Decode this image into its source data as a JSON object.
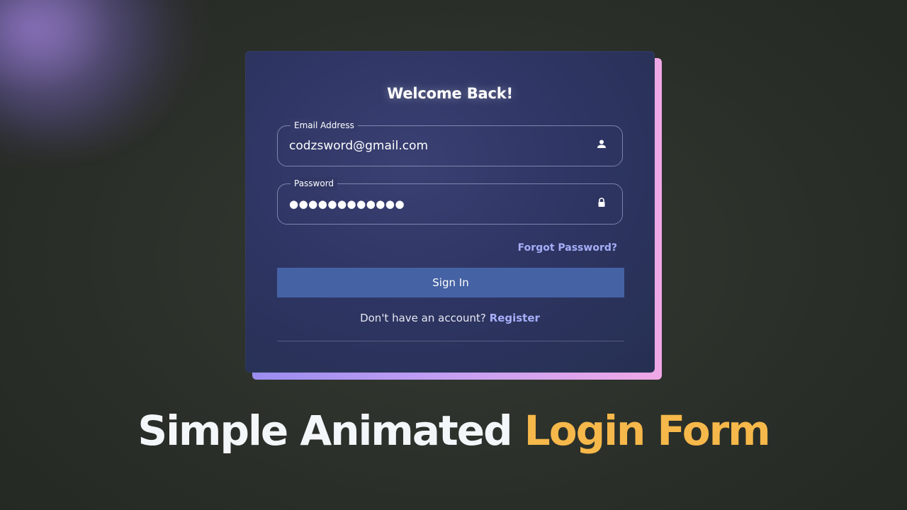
{
  "colors": {
    "card_bg": "#2e3563",
    "accent_gradient": [
      "#9a8cf0",
      "#f0a8e6"
    ],
    "button_bg": "#4562a4",
    "link": "#a7aef8",
    "headline_white": "#f4f7fa",
    "headline_accent": "#f6b84a"
  },
  "card": {
    "title": "Welcome Back!",
    "email": {
      "label": "Email Address",
      "value": "codzsword@gmail.com",
      "icon": "user-icon"
    },
    "password": {
      "label": "Password",
      "value": "●●●●●●●●●●●●",
      "icon": "lock-icon"
    },
    "forgot_link": "Forgot Password?",
    "signin_label": "Sign In",
    "register_prompt": "Don't have an account?",
    "register_link": "Register"
  },
  "headline": {
    "part1": "Simple Animated",
    "part2": "Login Form"
  }
}
